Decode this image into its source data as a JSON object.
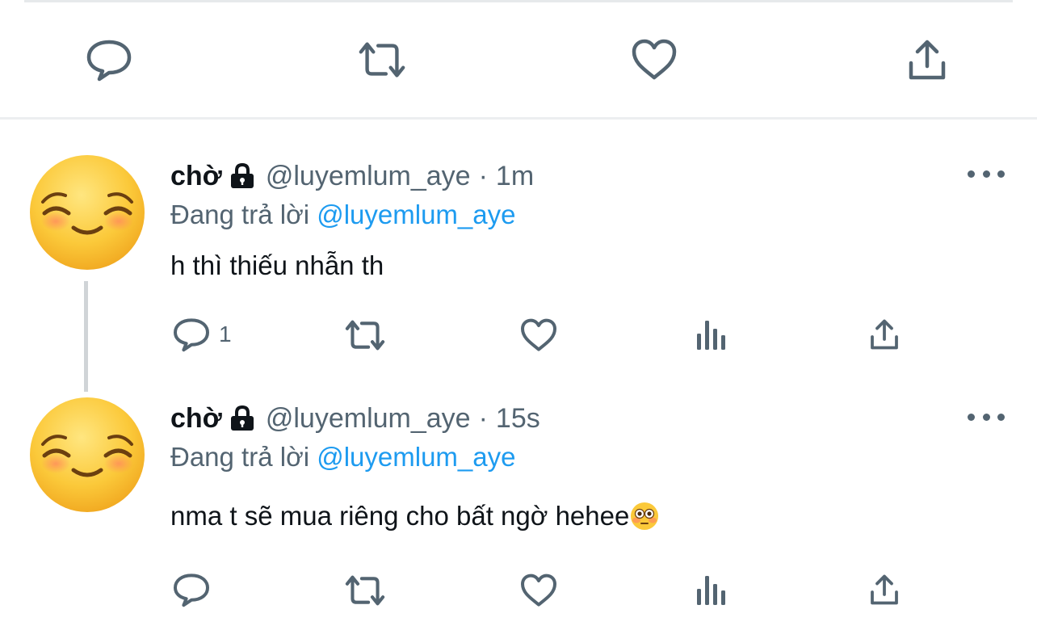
{
  "top_actions": {
    "icons": [
      "reply-icon",
      "retweet-icon",
      "like-icon",
      "share-icon"
    ]
  },
  "tweets": [
    {
      "avatar": "relieved-face-emoji",
      "name": "chờ",
      "handle": "@luyemlum_aye",
      "separator": "·",
      "time": "1m",
      "reply_prefix": "Đang trả lời",
      "reply_to": "@luyemlum_aye",
      "text": "h thì thiếu nhẫn th",
      "reply_count": "1"
    },
    {
      "avatar": "relieved-face-emoji",
      "name": "chờ",
      "handle": "@luyemlum_aye",
      "separator": "·",
      "time": "15s",
      "reply_prefix": "Đang trả lời",
      "reply_to": "@luyemlum_aye",
      "text": "nma t sẽ mua riêng cho bất ngờ hehee",
      "trailing_emoji": "flushed-face-emoji",
      "reply_count": ""
    }
  ],
  "colors": {
    "icon_gray": "#536471",
    "mention_blue": "#1d9bf0",
    "text": "#0f1419"
  }
}
